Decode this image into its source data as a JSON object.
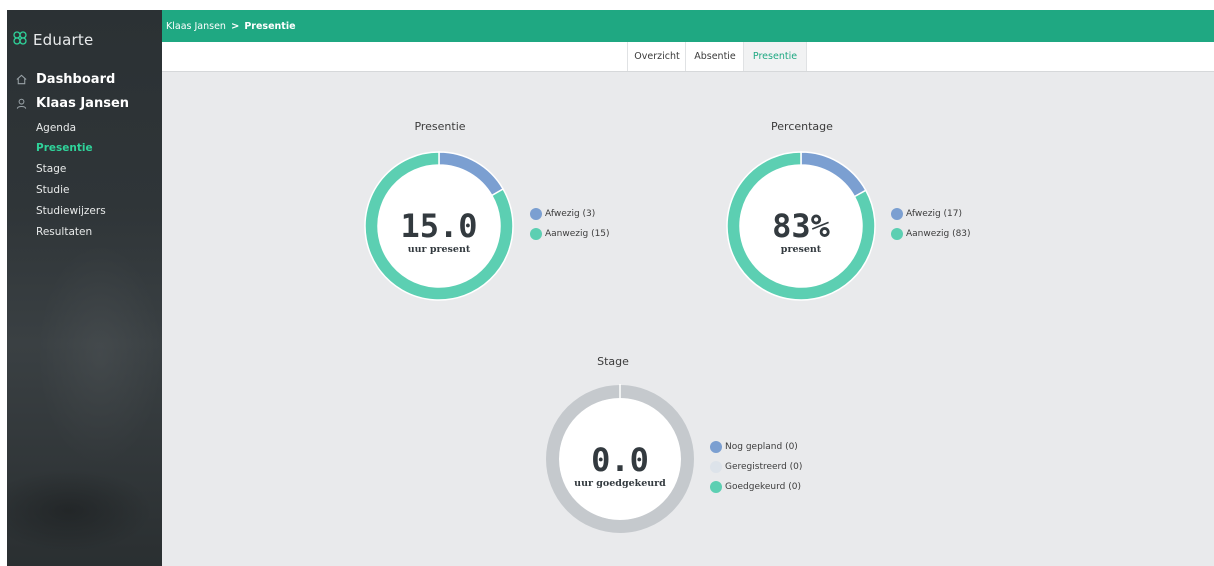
{
  "app": {
    "brand": "Eduarte"
  },
  "sidebar": {
    "dashboard": "Dashboard",
    "student": "Klaas Jansen",
    "items": [
      {
        "label": "Agenda"
      },
      {
        "label": "Presentie"
      },
      {
        "label": "Stage"
      },
      {
        "label": "Studie"
      },
      {
        "label": "Studiewijzers"
      },
      {
        "label": "Resultaten"
      }
    ],
    "active_item": "Presentie"
  },
  "breadcrumb": {
    "parent": "Klaas Jansen",
    "separator": ">",
    "current": "Presentie"
  },
  "tabs": [
    {
      "label": "Overzicht"
    },
    {
      "label": "Absentie"
    },
    {
      "label": "Presentie"
    }
  ],
  "active_tab": "Presentie",
  "colors": {
    "accent": "#1fa882",
    "afwezig": "#7b9fd1",
    "aanwezig": "#5ccfb2",
    "geregistreerd": "#dde3ea",
    "empty_ring": "#c5c9cd"
  },
  "chart_data": [
    {
      "type": "pie",
      "title": "Presentie",
      "center_value": "15.0",
      "center_label": "uur present",
      "series": [
        {
          "name": "Afwezig (3)",
          "value": 3,
          "color": "#7b9fd1"
        },
        {
          "name": "Aanwezig (15)",
          "value": 15,
          "color": "#5ccfb2"
        }
      ]
    },
    {
      "type": "pie",
      "title": "Percentage",
      "center_value": "83%",
      "center_label": "present",
      "series": [
        {
          "name": "Afwezig (17)",
          "value": 17,
          "color": "#7b9fd1"
        },
        {
          "name": "Aanwezig (83)",
          "value": 83,
          "color": "#5ccfb2"
        }
      ]
    },
    {
      "type": "pie",
      "title": "Stage",
      "center_value": "0.0",
      "center_label": "uur goedgekeurd",
      "series": [
        {
          "name": "Nog gepland (0)",
          "value": 0,
          "color": "#7b9fd1"
        },
        {
          "name": "Geregistreerd (0)",
          "value": 0,
          "color": "#dde3ea"
        },
        {
          "name": "Goedgekeurd (0)",
          "value": 0,
          "color": "#5ccfb2"
        }
      ]
    }
  ]
}
